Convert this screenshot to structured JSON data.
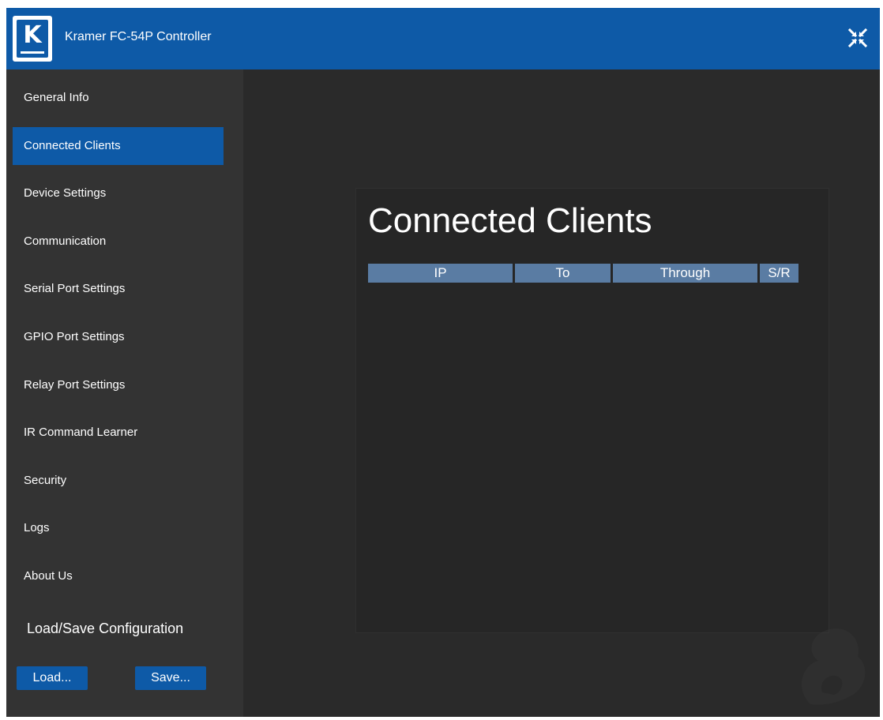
{
  "window": {
    "title": "Kramer FC-54P Controller",
    "logo_icon": "kramer-logo-icon",
    "close_icon": "collapse-arrows-icon"
  },
  "colors": {
    "accent": "#0e5aa7",
    "background": "#262626",
    "sidebar": "#333333",
    "table_header": "#5a7ca3"
  },
  "sidebar": {
    "items": [
      {
        "label": "General Info",
        "active": false
      },
      {
        "label": "Connected Clients",
        "active": true
      },
      {
        "label": "Device Settings",
        "active": false
      },
      {
        "label": "Communication",
        "active": false
      },
      {
        "label": "Serial Port Settings",
        "active": false
      },
      {
        "label": "GPIO Port Settings",
        "active": false
      },
      {
        "label": "Relay Port Settings",
        "active": false
      },
      {
        "label": "IR Command Learner",
        "active": false
      },
      {
        "label": "Security",
        "active": false
      },
      {
        "label": "Logs",
        "active": false
      },
      {
        "label": "About Us",
        "active": false
      }
    ],
    "load_save_heading": "Load/Save Configuration",
    "load_label": "Load...",
    "save_label": "Save..."
  },
  "main": {
    "title": "Connected Clients",
    "table": {
      "columns": [
        "IP",
        "To",
        "Through",
        "S/R"
      ],
      "rows": []
    }
  }
}
